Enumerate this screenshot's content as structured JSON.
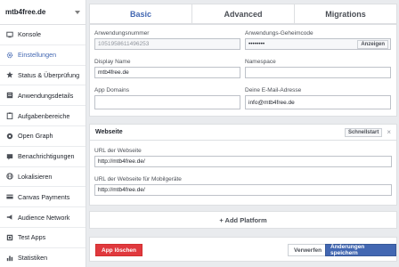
{
  "app": {
    "name": "mtb4free.de"
  },
  "sidebar": {
    "items": [
      {
        "label": "Konsole",
        "icon": "console-icon"
      },
      {
        "label": "Einstellungen",
        "icon": "gear-icon",
        "active": true
      },
      {
        "label": "Status & Überprüfung",
        "icon": "star-icon"
      },
      {
        "label": "Anwendungsdetails",
        "icon": "details-icon"
      },
      {
        "label": "Aufgabenbereiche",
        "icon": "clipboard-icon"
      },
      {
        "label": "Open Graph",
        "icon": "graph-icon"
      },
      {
        "label": "Benachrichtigungen",
        "icon": "bell-icon"
      },
      {
        "label": "Lokalisieren",
        "icon": "globe-icon"
      },
      {
        "label": "Canvas Payments",
        "icon": "card-icon"
      },
      {
        "label": "Audience Network",
        "icon": "megaphone-icon"
      },
      {
        "label": "Test Apps",
        "icon": "flask-icon"
      },
      {
        "label": "Statistiken",
        "icon": "chart-icon"
      }
    ]
  },
  "tabs": [
    {
      "label": "Basic",
      "active": true
    },
    {
      "label": "Advanced"
    },
    {
      "label": "Migrations"
    }
  ],
  "basic": {
    "app_id_label": "Anwendungsnummer",
    "app_id_value": "1051958611496253",
    "secret_label": "Anwendungs-Geheimcode",
    "secret_value": "••••••••",
    "secret_show": "Anzeigen",
    "display_name_label": "Display Name",
    "display_name_value": "mtb4free.de",
    "namespace_label": "Namespace",
    "namespace_value": "",
    "app_domains_label": "App Domains",
    "app_domains_value": "",
    "email_label": "Deine E-Mail-Adresse",
    "email_value": "info@mtb4free.de"
  },
  "website": {
    "title": "Webseite",
    "quickstart": "Schnellstart",
    "close": "×",
    "site_url_label": "URL der Webseite",
    "site_url_value": "http://mtb4free.de/",
    "mobile_url_label": "URL der Webseite für Mobilgeräte",
    "mobile_url_value": "http://mtb4free.de/"
  },
  "add_platform": "+ Add Platform",
  "footer": {
    "delete": "App löschen",
    "discard": "Verwerfen",
    "save": "Änderungen speichern"
  },
  "colors": {
    "accent": "#4267b2",
    "danger": "#e0393e",
    "background": "#e9ebee"
  }
}
